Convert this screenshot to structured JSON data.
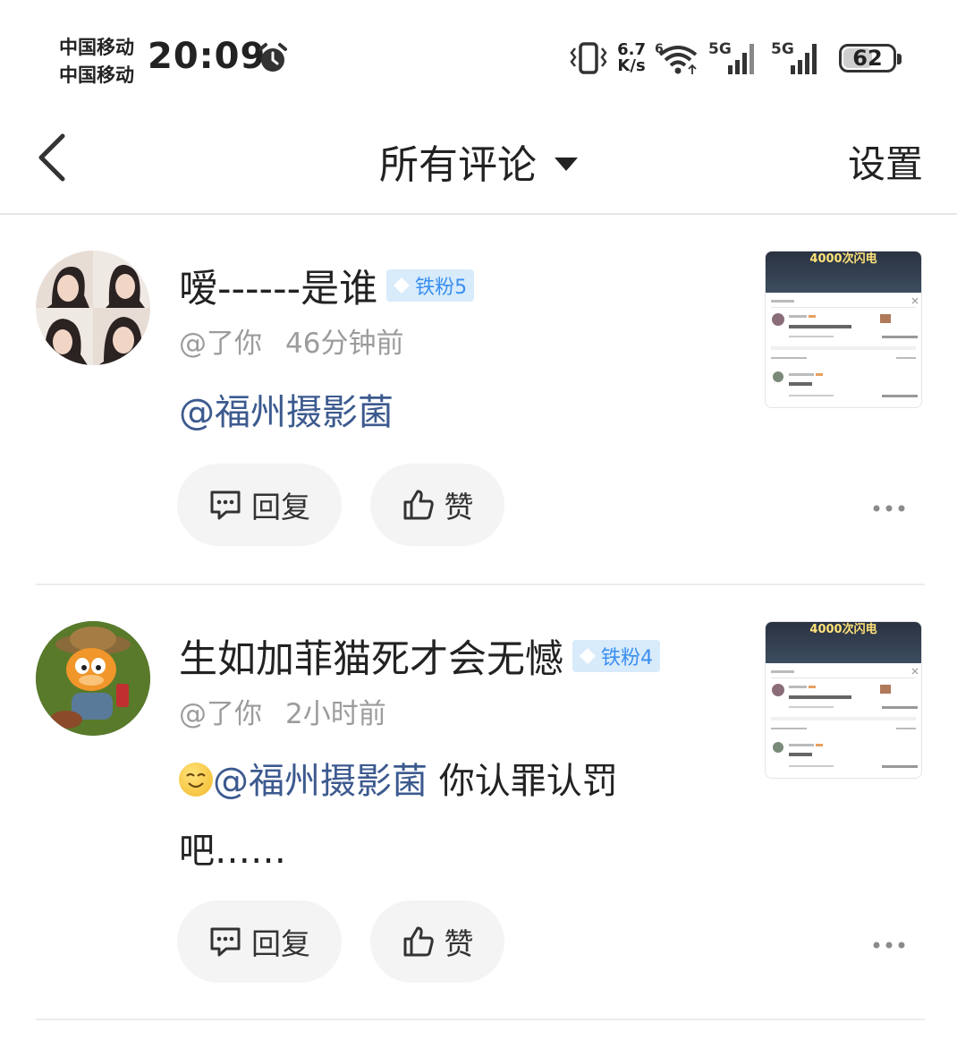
{
  "status_bar": {
    "carrier_1": "中国移动",
    "carrier_2": "中国移动",
    "time": "20:09",
    "net_speed_top": "6.7",
    "net_speed_bottom": "K/s",
    "signal_1_label": "5G",
    "signal_2_label": "5G",
    "battery": "62",
    "battery_level_percent": 62
  },
  "nav": {
    "title": "所有评论",
    "settings_label": "设置"
  },
  "comments": [
    {
      "username": "嗳------是谁",
      "badge": "铁粉5",
      "meta_to": "@了你",
      "time": "46分钟前",
      "mention": "@福州摄影菌",
      "text": "",
      "reply_label": "回复",
      "like_label": "赞",
      "thumb_caption": "4000次闪电"
    },
    {
      "username": "生如加菲猫死才会无憾",
      "badge": "铁粉4",
      "meta_to": "@了你",
      "time": "2小时前",
      "mention": "@福州摄影菌",
      "text_line1": " 你认罪认罚",
      "text_line2": "吧……",
      "reply_label": "回复",
      "like_label": "赞",
      "thumb_caption": "4000次闪电"
    }
  ],
  "colors": {
    "mention": "#3c5a8f",
    "badge_bg": "#d8ebfb",
    "badge_text": "#3a8ff0",
    "button_bg": "#f4f4f4"
  },
  "icons": [
    "alarm-icon",
    "vibrate-icon",
    "wifi-icon",
    "signal-icon",
    "battery-icon",
    "back-chevron-icon",
    "dropdown-caret-icon",
    "diamond-icon",
    "comment-bubble-icon",
    "thumbs-up-icon",
    "more-dots-icon",
    "smile-emoji-icon"
  ]
}
